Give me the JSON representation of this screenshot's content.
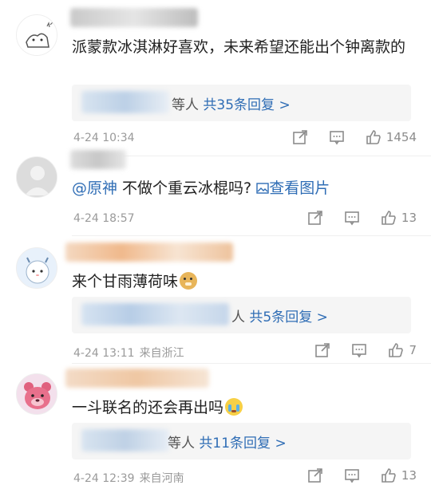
{
  "comments": [
    {
      "text": "派蒙款冰淇淋好喜欢，未来希望还能出个钟离款的",
      "reply_suffix": "等人",
      "reply_count": "共35条回复 >",
      "time": "4-24 10:34",
      "location": "",
      "likes": "1454"
    },
    {
      "mention": "@原神",
      "text": " 不做个重云冰棍吗?",
      "link_icon": "image-icon",
      "link_text": "查看图片",
      "time": "4-24 18:57",
      "location": "",
      "likes": "13"
    },
    {
      "text": "来个甘雨薄荷味",
      "emoji": "doge-emoji",
      "reply_suffix": "人",
      "reply_count": "共5条回复 >",
      "time": "4-24 13:11",
      "location": "来自浙江",
      "likes": "7"
    },
    {
      "text": "一斗联名的还会再出吗",
      "emoji": "crying-emoji",
      "reply_suffix": "等人",
      "reply_count": "共11条回复 >",
      "time": "4-24 12:39",
      "location": "来自河南",
      "likes": "13"
    }
  ],
  "colors": {
    "link": "#2f6db5",
    "meta": "#9a9a9a",
    "reply_bg": "#f5f5f5"
  }
}
